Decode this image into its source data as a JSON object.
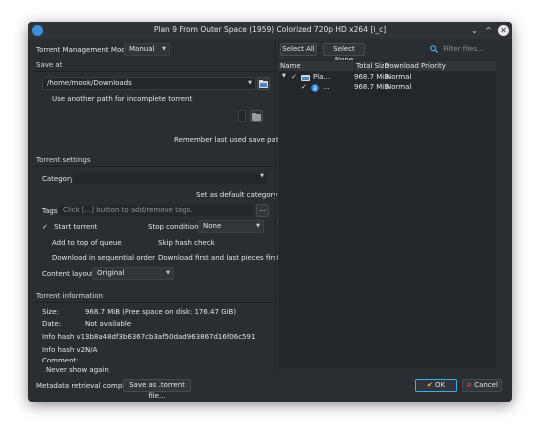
{
  "window": {
    "title": "Plan 9 From Outer Space (1959) Colorized 720p HD x264 [i_c]"
  },
  "titlebar": {
    "minimize": "⌄",
    "maximize": "^",
    "close": "✕"
  },
  "management": {
    "label": "Torrent Management Mode:",
    "value": "Manual"
  },
  "save_at": {
    "heading": "Save at",
    "path": "/home/mook/Downloads",
    "incomplete_label": "Use another path for incomplete torrent",
    "remember_label": "Remember last used save path"
  },
  "settings": {
    "heading": "Torrent settings",
    "category_label": "Category:",
    "category_value": "",
    "set_default_label": "Set as default category",
    "tags_label": "Tags:",
    "tags_placeholder": "Click [...] button to add/remove tags.",
    "tags_button": "...",
    "start_torrent": "Start torrent",
    "stop_condition_label": "Stop condition:",
    "stop_condition_value": "None",
    "add_top_queue": "Add to top of queue",
    "skip_hash": "Skip hash check",
    "sequential": "Download in sequential order",
    "first_last": "Download first and last pieces first",
    "content_layout_label": "Content layout:",
    "content_layout_value": "Original"
  },
  "info": {
    "heading": "Torrent information",
    "size_label": "Size:",
    "size_value": "968.7 MiB (Free space on disk: 176.47 GiB)",
    "date_label": "Date:",
    "date_value": "Not available",
    "hash1_label": "Info hash v1:",
    "hash1_value": "3b8a48df3b6367cb3af50dad963867d16f06c591",
    "hash2_label": "Info hash v2:",
    "hash2_value": "N/A",
    "comment_label": "Comment:"
  },
  "bottom": {
    "never_show": "Never show again",
    "metadata": "Metadata retrieval complete",
    "save_torrent": "Save as .torrent file...",
    "ok": "OK",
    "cancel": "Cancel"
  },
  "files": {
    "select_all": "Select All",
    "select_none": "Select None",
    "filter_placeholder": "Filter files...",
    "columns": [
      "Name",
      "Total Size",
      "Download Priority"
    ],
    "rows": [
      {
        "name": "Pla...",
        "size": "968.7 MiB",
        "priority": "Normal"
      },
      {
        "name": "...",
        "size": "968.7 MiB",
        "priority": "Normal"
      }
    ]
  },
  "colors": {
    "accent": "#3daee9",
    "ok_icon": "#f0c040",
    "cancel_icon": "#e05050"
  }
}
